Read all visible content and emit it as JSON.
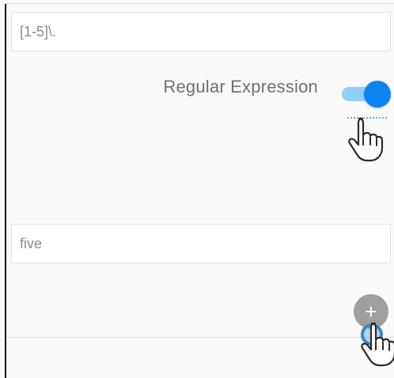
{
  "form": {
    "pattern_value": "[1-5]\\.",
    "regex_label": "Regular Expression",
    "regex_toggle_on": true,
    "replacement_value": "five",
    "add_button_glyph": "+"
  },
  "colors": {
    "toggle_track": "#8fd0f7",
    "toggle_thumb": "#0a85f0",
    "add_button": "#9f9f9f",
    "click_ring": "#3d86c4"
  },
  "icons": {
    "cursor": "hand-pointer-icon",
    "add": "plus-icon"
  }
}
